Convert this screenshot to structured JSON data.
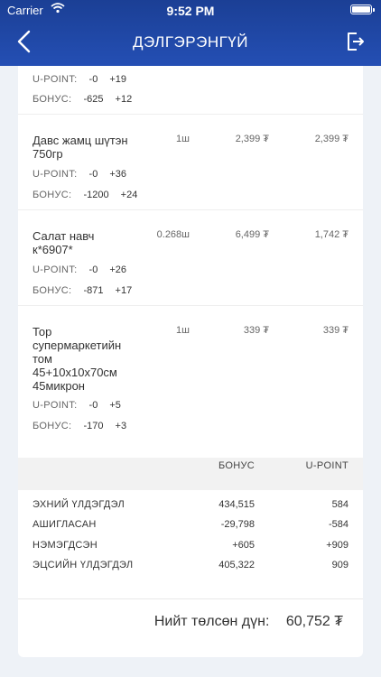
{
  "status": {
    "carrier": "Carrier",
    "time": "9:52 PM"
  },
  "header": {
    "title": "ДЭЛГЭРЭНГҮЙ"
  },
  "labels": {
    "upoint": "U-POINT:",
    "bonus": "БОНУС:"
  },
  "items": [
    {
      "name": "",
      "qty": "",
      "price": "",
      "total": "",
      "upoint_a": "-0",
      "upoint_b": "+19",
      "bonus_a": "-625",
      "bonus_b": "+12"
    },
    {
      "name": "Давс жамц шүтэн 750гр",
      "qty": "1ш",
      "price": "2,399 ₮",
      "total": "2,399 ₮",
      "upoint_a": "-0",
      "upoint_b": "+36",
      "bonus_a": "-1200",
      "bonus_b": "+24"
    },
    {
      "name": "Салат навч к*6907*",
      "qty": "0.268ш",
      "price": "6,499 ₮",
      "total": "1,742 ₮",
      "upoint_a": "-0",
      "upoint_b": "+26",
      "bonus_a": "-871",
      "bonus_b": "+17"
    },
    {
      "name": "Тор супермаркетийн том 45+10x10x70см 45микрон",
      "qty": "1ш",
      "price": "339 ₮",
      "total": "339 ₮",
      "upoint_a": "-0",
      "upoint_b": "+5",
      "bonus_a": "-170",
      "bonus_b": "+3"
    }
  ],
  "summary": {
    "col_bonus": "БОНУС",
    "col_upoint": "U-POINT",
    "rows": [
      {
        "label": "ЭХНИЙ ҮЛДЭГДЭЛ",
        "bonus": "434,515",
        "upoint": "584"
      },
      {
        "label": "АШИГЛАСАН",
        "bonus": "-29,798",
        "upoint": "-584"
      },
      {
        "label": "НЭМЭГДСЭН",
        "bonus": "+605",
        "upoint": "+909"
      },
      {
        "label": "ЭЦСИЙН ҮЛДЭГДЭЛ",
        "bonus": "405,322",
        "upoint": "909"
      }
    ]
  },
  "footer": {
    "total_label": "Нийт төлсөн дүн:",
    "total_amount": "60,752 ₮"
  },
  "colors": {
    "header_bg": "#244fb4",
    "page_bg": "#eef2f7",
    "card_bg": "#ffffff"
  },
  "icons": {
    "back": "chevron-left-icon",
    "logout": "logout-icon",
    "wifi": "wifi-icon",
    "battery": "battery-icon"
  }
}
